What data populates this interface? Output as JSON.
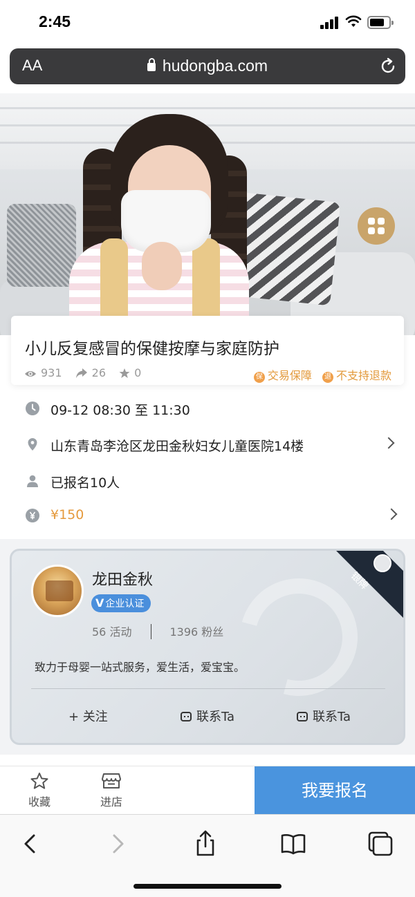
{
  "status_bar": {
    "time": "2:45"
  },
  "browser": {
    "aa_label": "AA",
    "domain": "hudongba.com"
  },
  "event": {
    "title": "小儿反复感冒的保健按摩与家庭防护",
    "views": "931",
    "shares": "26",
    "favorites": "0",
    "tags": [
      {
        "icon_char": "保",
        "label": "交易保障"
      },
      {
        "icon_char": "退",
        "label": "不支持退款"
      }
    ],
    "time": "09-12 08:30 至 11:30",
    "address": "山东青岛李沧区龙田金秋妇女儿童医院14楼",
    "registered": "已报名10人",
    "price": "¥150"
  },
  "organizer": {
    "name": "龙田金秋",
    "verify_mark": "V",
    "verify_label": "企业认证",
    "activities": "56 活动",
    "fans": "1396 粉丝",
    "description": "致力于母婴一站式服务，爱生活，爱宝宝。",
    "level_badge": "银牌",
    "actions": {
      "follow": "+ 关注",
      "contact_1": "联系Ta",
      "contact_2": "联系Ta"
    }
  },
  "action_bar": {
    "favorite": "收藏",
    "store": "进店",
    "signup": "我要报名"
  },
  "colors": {
    "accent_blue": "#4a94de",
    "price_orange": "#e59a3d",
    "gold": "#c9a46a",
    "verify_blue": "#4a8fdc"
  }
}
